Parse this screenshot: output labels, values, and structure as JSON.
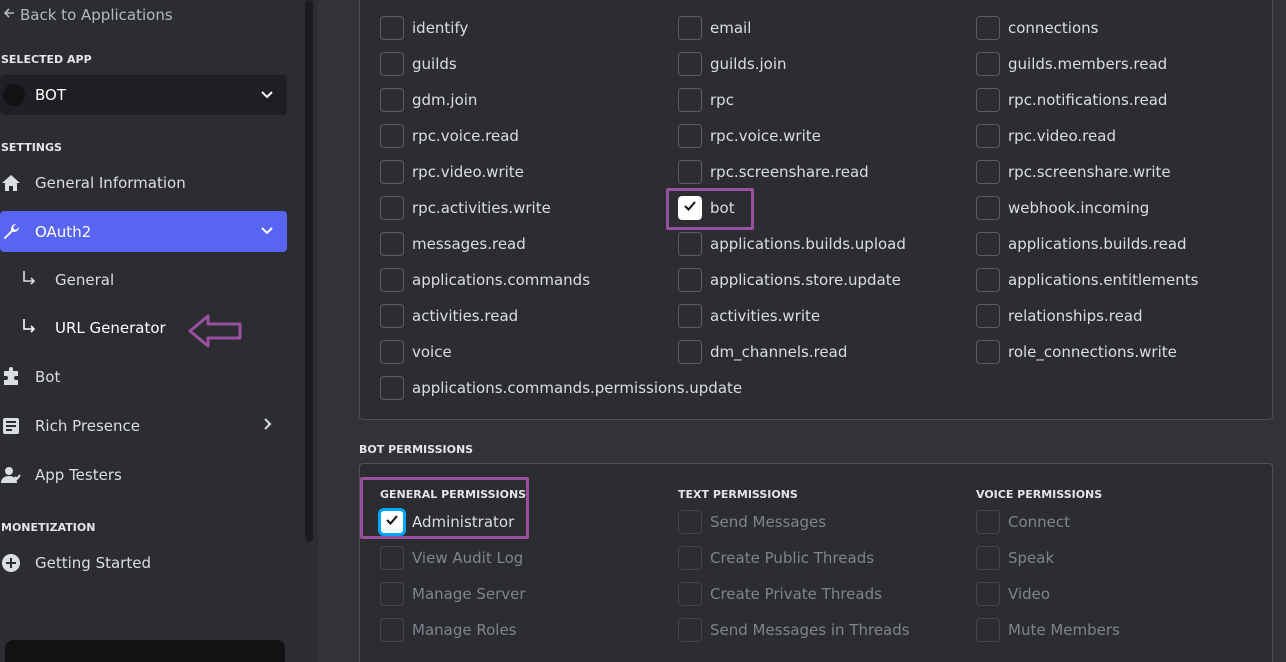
{
  "sidebar": {
    "back_label": "Back to Applications",
    "selected_app_heading": "SELECTED APP",
    "app_name": "BOT",
    "settings_heading": "SETTINGS",
    "monetization_heading": "MONETIZATION",
    "items": {
      "general_information": "General Information",
      "oauth2": "OAuth2",
      "general": "General",
      "url_generator": "URL Generator",
      "bot": "Bot",
      "rich_presence": "Rich Presence",
      "app_testers": "App Testers",
      "getting_started": "Getting Started"
    },
    "active_color": "#5865f2"
  },
  "scopes": {
    "col1": [
      "identify",
      "guilds",
      "gdm.join",
      "rpc.voice.read",
      "rpc.video.write",
      "rpc.activities.write",
      "messages.read",
      "applications.commands",
      "activities.read",
      "voice",
      "applications.commands.permissions.update"
    ],
    "col2": [
      "email",
      "guilds.join",
      "rpc",
      "rpc.voice.write",
      "rpc.screenshare.read",
      "bot",
      "applications.builds.upload",
      "applications.store.update",
      "activities.write",
      "dm_channels.read"
    ],
    "col3": [
      "connections",
      "guilds.members.read",
      "rpc.notifications.read",
      "rpc.video.read",
      "rpc.screenshare.write",
      "webhook.incoming",
      "applications.builds.read",
      "applications.entitlements",
      "relationships.read",
      "role_connections.write"
    ],
    "checked": [
      "bot"
    ]
  },
  "bot_permissions": {
    "heading": "BOT PERMISSIONS",
    "general": {
      "heading": "GENERAL PERMISSIONS",
      "items": [
        "Administrator",
        "View Audit Log",
        "Manage Server",
        "Manage Roles"
      ]
    },
    "text": {
      "heading": "TEXT PERMISSIONS",
      "items": [
        "Send Messages",
        "Create Public Threads",
        "Create Private Threads",
        "Send Messages in Threads"
      ]
    },
    "voice": {
      "heading": "VOICE PERMISSIONS",
      "items": [
        "Connect",
        "Speak",
        "Video",
        "Mute Members"
      ]
    },
    "checked": [
      "Administrator"
    ]
  },
  "annotation_color": "#9b4f9f"
}
